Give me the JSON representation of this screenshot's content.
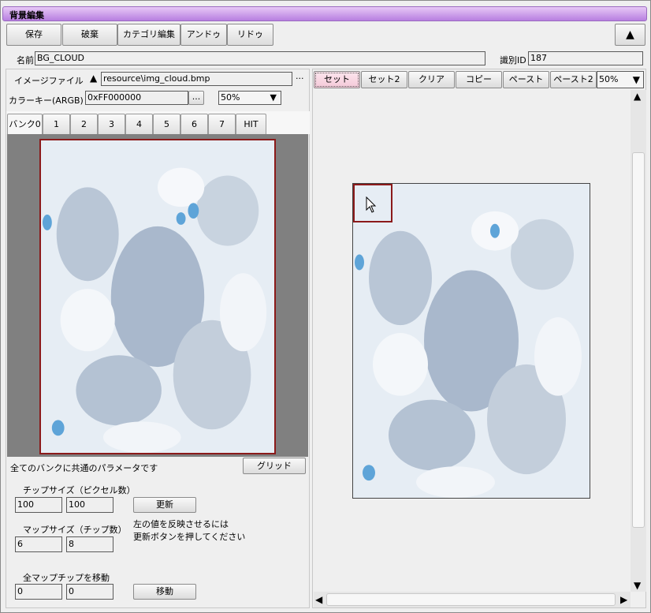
{
  "window": {
    "title": "背景編集"
  },
  "toolbar": {
    "save": "保存",
    "discard": "破棄",
    "category_edit": "カテゴリ編集",
    "undo": "アンドゥ",
    "redo": "リドゥ",
    "collapse_glyph": "▲"
  },
  "form": {
    "name_label": "名前",
    "name_value": "BG_CLOUD",
    "id_label": "識別ID",
    "id_value": "187",
    "image_file_label": "イメージファイル",
    "image_file_value": "resource\\img_cloud.bmp",
    "browse_glyph": "...",
    "sort_glyph": "▲",
    "colorkey_label": "カラーキー(ARGB)",
    "colorkey_value": "0xFF000000",
    "zoom_left": "50%"
  },
  "tabs": [
    "バンク0",
    "1",
    "2",
    "3",
    "4",
    "5",
    "6",
    "7",
    "HIT"
  ],
  "bottom": {
    "common_params": "全てのバンクに共通のパラメータです",
    "grid_button": "グリッド",
    "chip_size_label": "チップサイズ（ピクセル数）",
    "chip_w": "100",
    "chip_h": "100",
    "update_button": "更新",
    "map_size_label": "マップサイズ（チップ数）",
    "map_w": "6",
    "map_h": "8",
    "note_line1": "左の値を反映させるには",
    "note_line2": "更新ボタンを押してください",
    "move_label": "全マップチップを移動",
    "move_x": "0",
    "move_y": "0",
    "move_button": "移動"
  },
  "right_toolbar": {
    "set": "セット",
    "set2": "セット2",
    "clear": "クリア",
    "copy": "コピー",
    "paste": "ペースト",
    "paste2": "ペースト2",
    "zoom": "50%"
  },
  "scroll": {
    "up": "▲",
    "down": "▼",
    "left": "◀",
    "right": "▶"
  },
  "dropdown_glyph": "▼",
  "colors": {
    "title_gradient_top": "#e7c8f6",
    "title_gradient_bottom": "#b77fe0",
    "selection_border": "#8b1a1a",
    "cloud_sky": "#5ea4d8"
  }
}
